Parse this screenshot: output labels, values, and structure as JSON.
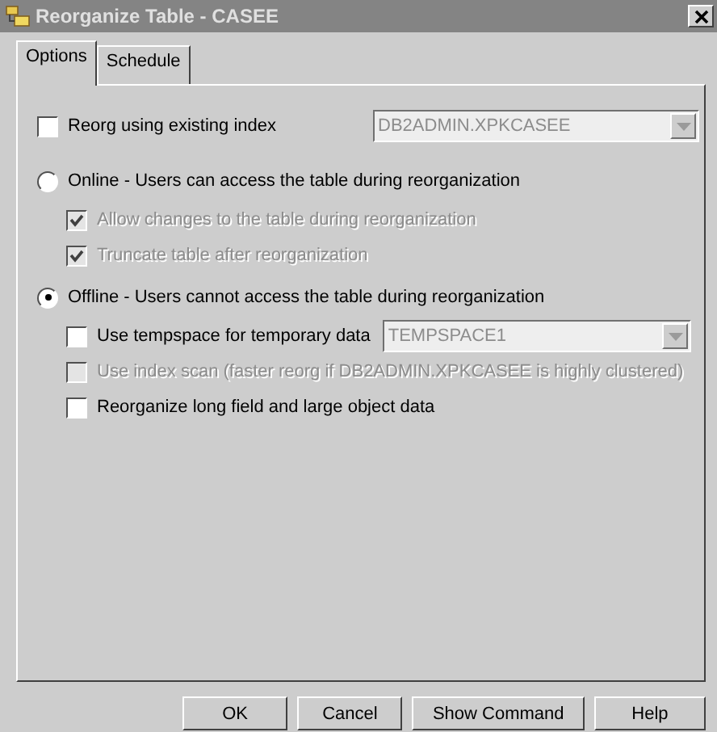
{
  "window": {
    "title": "Reorganize Table - CASEE"
  },
  "tabs": [
    {
      "label": "Options",
      "selected": true
    },
    {
      "label": "Schedule",
      "selected": false
    }
  ],
  "reorg_index": {
    "label": "Reorg using existing index",
    "checked": false,
    "dropdown": {
      "value": "DB2ADMIN.XPKCASEE",
      "disabled": true
    }
  },
  "modes": [
    {
      "label": "Online - Users can access the table during reorganization",
      "selected": false,
      "options": [
        {
          "label": "Allow changes to the table during reorganization",
          "checked": true,
          "disabled": true
        },
        {
          "label": "Truncate table after reorganization",
          "checked": true,
          "disabled": true
        }
      ]
    },
    {
      "label": "Offline - Users cannot access the table during reorganization",
      "selected": true,
      "options": [
        {
          "label": "Use tempspace for temporary data",
          "checked": false,
          "disabled": false,
          "dropdown": {
            "value": "TEMPSPACE1",
            "disabled": true
          }
        },
        {
          "label": "Use index scan (faster reorg if DB2ADMIN.XPKCASEE is highly clustered)",
          "checked": false,
          "disabled": true
        },
        {
          "label": "Reorganize long field and large object data",
          "checked": false,
          "disabled": false
        }
      ]
    }
  ],
  "buttons": [
    "OK",
    "Cancel",
    "Show Command",
    "Help"
  ]
}
